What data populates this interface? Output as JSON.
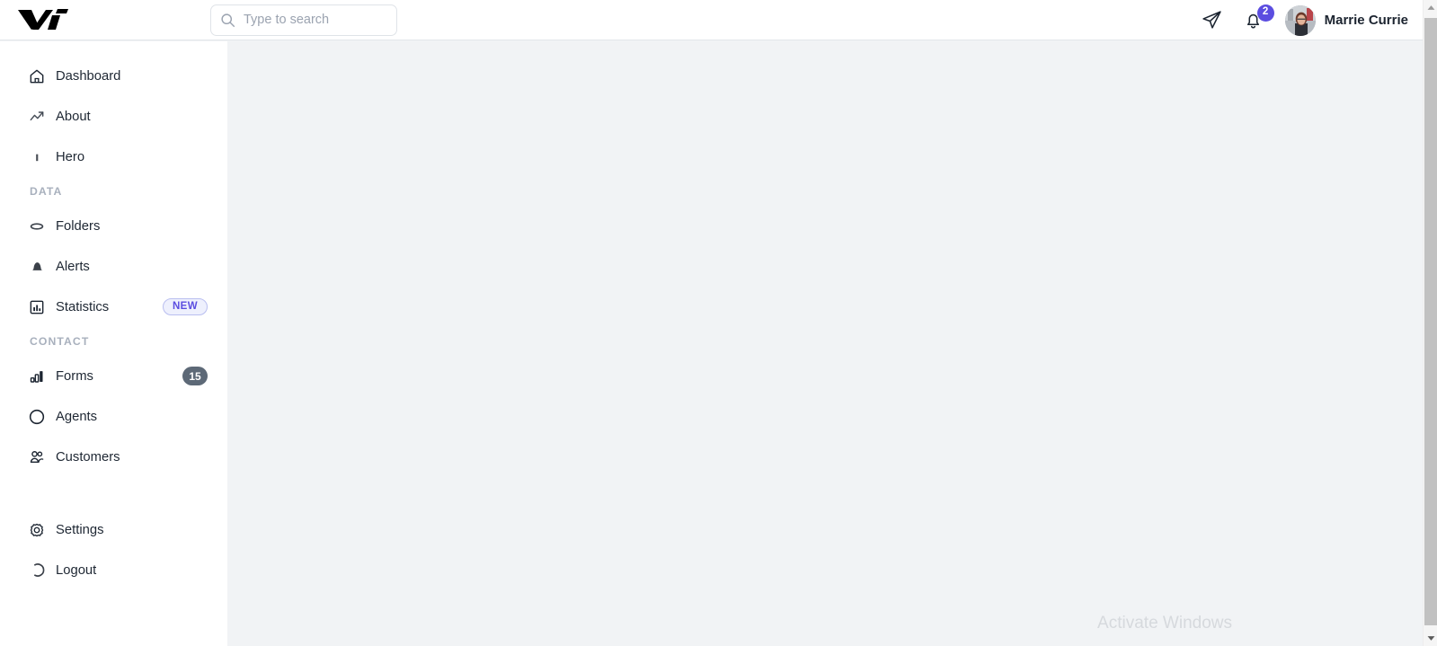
{
  "header": {
    "logo_alt": "Vi",
    "search": {
      "placeholder": "Type to search",
      "value": "",
      "icon": "search-icon"
    },
    "send_icon": "paper-plane-icon",
    "notifications": {
      "icon": "bell-icon",
      "count": "2",
      "badge_color": "#5b4de0"
    },
    "user": {
      "name": "Marrie Currie",
      "avatar_alt": "user-avatar-photo"
    }
  },
  "sidebar": {
    "groups": [
      {
        "label": null,
        "items": [
          {
            "label": "Dashboard",
            "icon": "home-icon",
            "badge": null
          },
          {
            "label": "About",
            "icon": "trend-line-icon",
            "badge": null
          },
          {
            "label": "Hero",
            "icon": "bar-icon",
            "badge": null
          }
        ]
      },
      {
        "label": "DATA",
        "items": [
          {
            "label": "Folders",
            "icon": "disc-icon",
            "badge": null
          },
          {
            "label": "Alerts",
            "icon": "bell-filled-icon",
            "badge": null
          },
          {
            "label": "Statistics",
            "icon": "chart-box-icon",
            "badge": {
              "text": "NEW",
              "style": "new"
            }
          }
        ]
      },
      {
        "label": "CONTACT",
        "items": [
          {
            "label": "Forms",
            "icon": "bar-chart-icon",
            "badge": {
              "text": "15",
              "style": "count"
            }
          },
          {
            "label": "Agents",
            "icon": "circle-icon",
            "badge": null
          },
          {
            "label": "Customers",
            "icon": "users-icon",
            "badge": null
          }
        ]
      },
      {
        "label": null,
        "items": [
          {
            "label": "Settings",
            "icon": "gear-icon",
            "badge": null
          },
          {
            "label": "Logout",
            "icon": "power-arc-icon",
            "badge": null
          }
        ]
      }
    ]
  },
  "main": {
    "watermark": "Activate Windows"
  },
  "colors": {
    "accent": "#5b4de0",
    "sidebar_bg": "#ffffff",
    "content_bg": "#f1f3f5",
    "text": "#1e2733",
    "muted": "#a8b0bd",
    "badge_count_bg": "#5d6977"
  }
}
